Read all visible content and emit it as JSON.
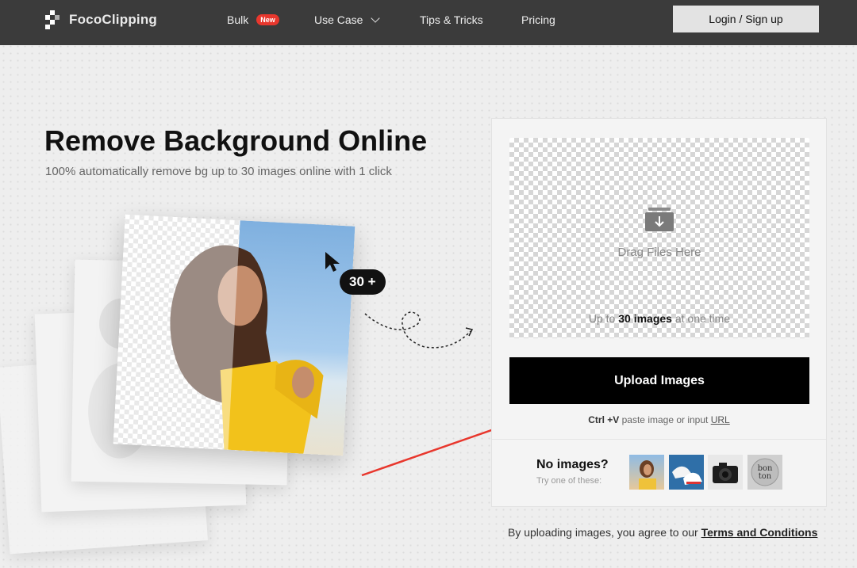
{
  "brand": {
    "name": "FocoClipping"
  },
  "nav": {
    "bulk": "Bulk",
    "bulk_badge": "New",
    "use_case": "Use Case",
    "tips": "Tips & Tricks",
    "pricing": "Pricing",
    "login": "Login / Sign up"
  },
  "hero": {
    "title": "Remove Background Online",
    "subtitle": "100% automatically remove bg up to 30 images online with 1 click",
    "badge": "30 +"
  },
  "upload": {
    "drag_text": "Drag Files Here",
    "limit_prefix": "Up to",
    "limit_count": "30 images",
    "limit_suffix": "at one time",
    "button": "Upload Images",
    "paste_key": "Ctrl +V",
    "paste_text": "paste image or input",
    "url_link": "URL"
  },
  "samples": {
    "title": "No images?",
    "subtitle": "Try one of these:",
    "thumbs": [
      "woman-sample",
      "sneakers-sample",
      "camera-sample",
      "bonton-logo-sample"
    ],
    "logo_text": "bon ton"
  },
  "footer": {
    "terms_prefix": "By uploading images, you agree to our",
    "terms_link": "Terms and Conditions"
  },
  "colors": {
    "nav_bg": "#3b3b3b",
    "accent_red": "#e8372d",
    "button_bg": "#000000"
  }
}
